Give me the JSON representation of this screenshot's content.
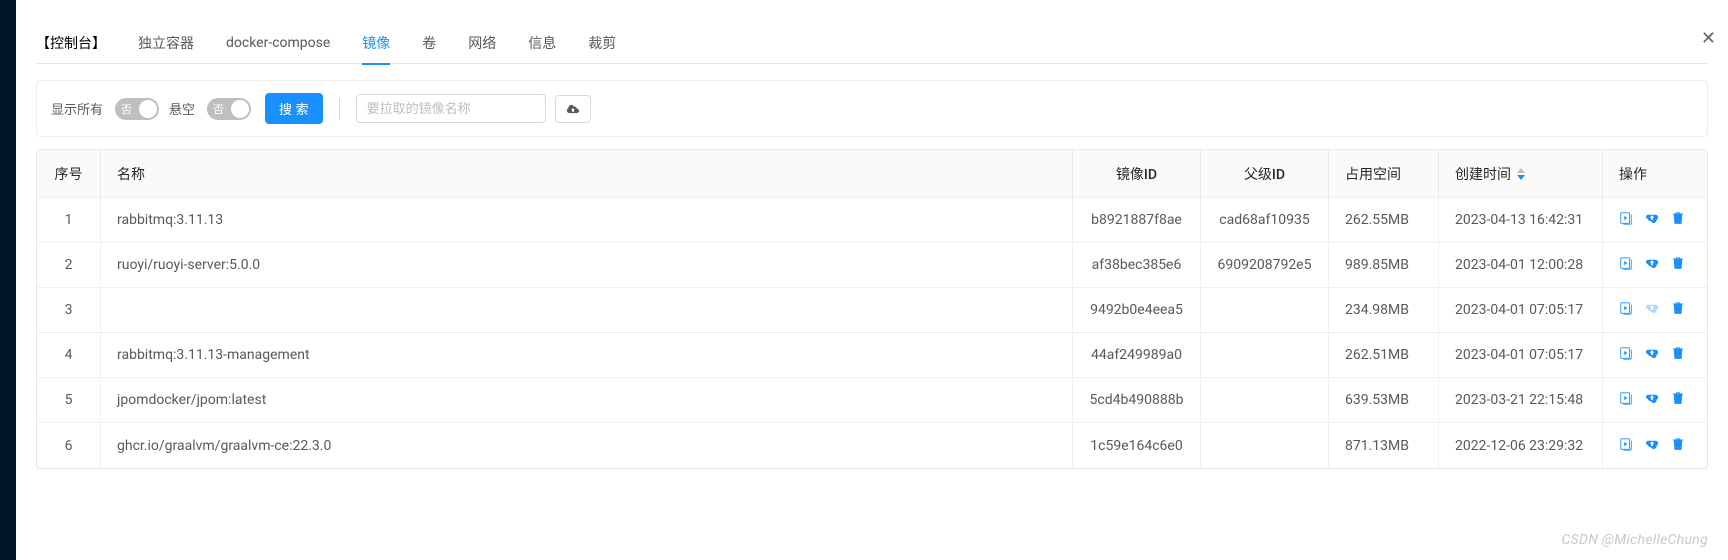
{
  "header": {
    "title_label": "【控制台】",
    "tabs": [
      {
        "label": "独立容器"
      },
      {
        "label": "docker-compose"
      },
      {
        "label": "镜像",
        "active": true
      },
      {
        "label": "卷"
      },
      {
        "label": "网络"
      },
      {
        "label": "信息"
      },
      {
        "label": "裁剪"
      }
    ]
  },
  "toolbar": {
    "show_all_label": "显示所有",
    "dangling_label": "悬空",
    "switch_off_text": "否",
    "search_label": "搜 索",
    "pull_placeholder": "要拉取的镜像名称"
  },
  "table": {
    "headers": {
      "idx": "序号",
      "name": "名称",
      "image_id": "镜像ID",
      "parent_id": "父级ID",
      "size": "占用空间",
      "created": "创建时间",
      "ops": "操作"
    },
    "rows": [
      {
        "idx": "1",
        "name": "rabbitmq:3.11.13",
        "image_id": "b8921887f8ae",
        "parent_id": "cad68af10935",
        "size": "262.55MB",
        "created": "2023-04-13 16:42:31",
        "upload_dim": false
      },
      {
        "idx": "2",
        "name": "ruoyi/ruoyi-server:5.0.0",
        "image_id": "af38bec385e6",
        "parent_id": "6909208792e5",
        "size": "989.85MB",
        "created": "2023-04-01 12:00:28",
        "upload_dim": false
      },
      {
        "idx": "3",
        "name": "",
        "image_id": "9492b0e4eea5",
        "parent_id": "",
        "size": "234.98MB",
        "created": "2023-04-01 07:05:17",
        "upload_dim": true
      },
      {
        "idx": "4",
        "name": "rabbitmq:3.11.13-management",
        "image_id": "44af249989a0",
        "parent_id": "",
        "size": "262.51MB",
        "created": "2023-04-01 07:05:17",
        "upload_dim": false
      },
      {
        "idx": "5",
        "name": "jpomdocker/jpom:latest",
        "image_id": "5cd4b490888b",
        "parent_id": "",
        "size": "639.53MB",
        "created": "2023-03-21 22:15:48",
        "upload_dim": false
      },
      {
        "idx": "6",
        "name": "ghcr.io/graalvm/graalvm-ce:22.3.0",
        "image_id": "1c59e164c6e0",
        "parent_id": "",
        "size": "871.13MB",
        "created": "2022-12-06 23:29:32",
        "upload_dim": false
      }
    ]
  },
  "watermark": "CSDN @MichelleChung"
}
